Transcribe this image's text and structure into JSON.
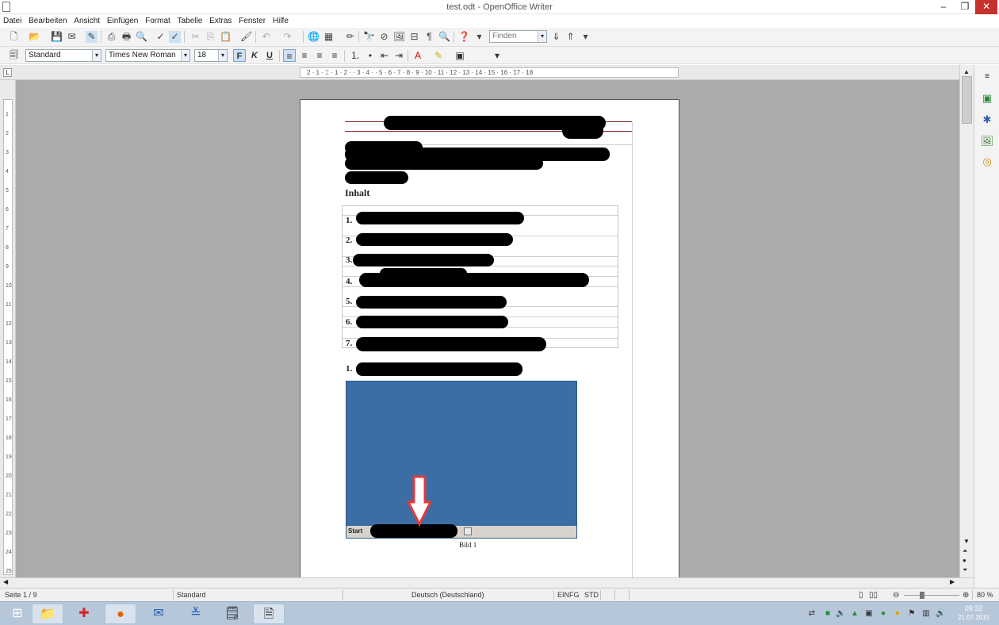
{
  "window": {
    "title": "test.odt - OpenOffice Writer",
    "minimize": "–",
    "restore": "❐",
    "close": "✕"
  },
  "menu": [
    "Datei",
    "Bearbeiten",
    "Ansicht",
    "Einfügen",
    "Format",
    "Tabelle",
    "Extras",
    "Fenster",
    "Hilfe"
  ],
  "toolbar": {
    "find_placeholder": "Finden"
  },
  "format_toolbar": {
    "style": "Standard",
    "font": "Times New Roman",
    "size": "18",
    "bold": "F",
    "italic": "K",
    "underline": "U"
  },
  "ruler": {
    "text": "2 · 1 · ⌶ · 1 · 2 · · 3 · 4 · · 5 · 6 · 7 · 8 · 9 · 10 · 11 · 12 · 13 · 14 · 15 · 16 · 17 · 18"
  },
  "vruler": [
    "1",
    "2",
    "3",
    "4",
    "5",
    "6",
    "7",
    "8",
    "9",
    "10",
    "11",
    "12",
    "13",
    "14",
    "15",
    "16",
    "17",
    "18",
    "19",
    "20",
    "21",
    "22",
    "23",
    "24",
    "25"
  ],
  "document": {
    "heading": "Inhalt",
    "toc_numbers": [
      "1.",
      "2.",
      "3.",
      "4.",
      "5.",
      "6.",
      "7."
    ],
    "section_number": "1.",
    "screenshot_start_label": "Start",
    "caption": "Bild 1",
    "colors": {
      "desktop": "#3c6ea5",
      "arrow": "#e03a3a"
    }
  },
  "statusbar": {
    "page": "Seite 1 / 9",
    "style": "Standard",
    "language": "Deutsch (Deutschland)",
    "insert_mode": "EINFG",
    "selection_mode": "STD",
    "zoom": "80 %"
  },
  "taskbar": {
    "time": "09:32",
    "date": "21.07.2015"
  }
}
